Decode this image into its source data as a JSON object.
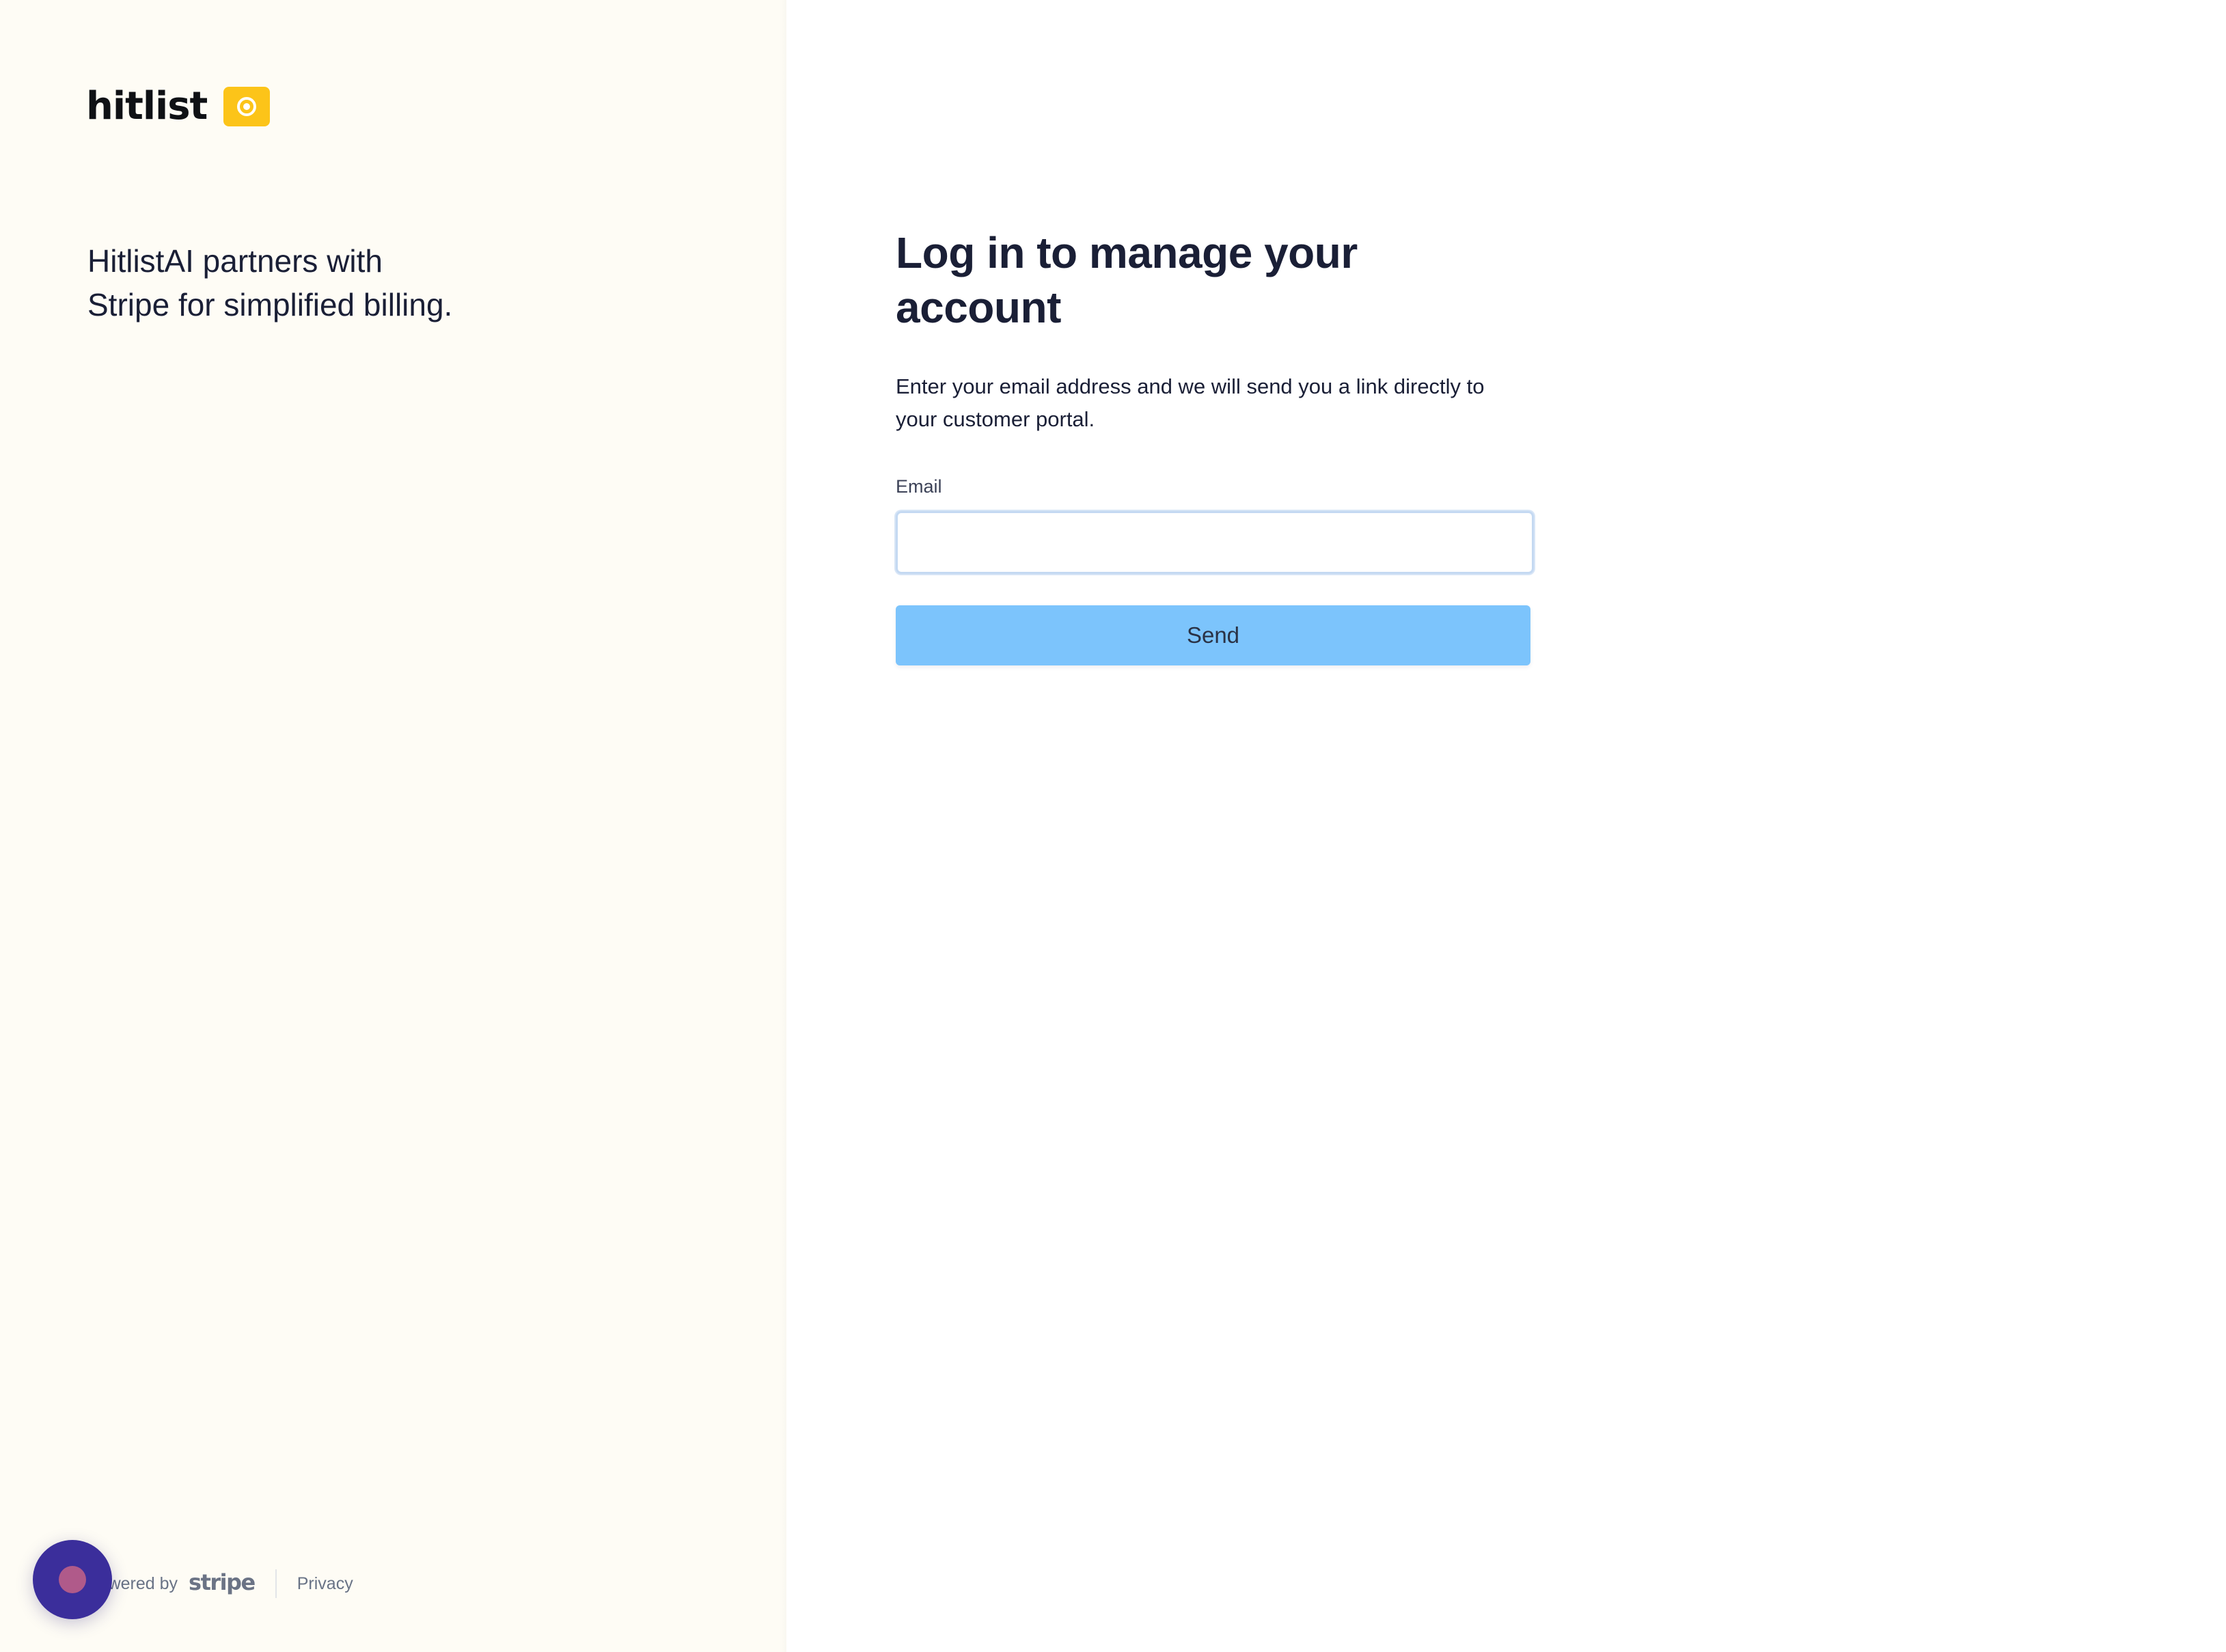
{
  "brand": {
    "logo_text": "hitlist",
    "badge_icon": "target-icon",
    "accent_color": "#fcc419"
  },
  "left_panel": {
    "tagline_line1": "HitlistAI partners with",
    "tagline_line2": "Stripe for simplified billing.",
    "background_color": "#fefcf5"
  },
  "footer": {
    "powered_by_text": "Powered by",
    "stripe_wordmark": "stripe",
    "privacy_label": "Privacy"
  },
  "form": {
    "title": "Log in to manage your account",
    "description": "Enter your email address and we will send you a link directly to your customer portal.",
    "email_label": "Email",
    "email_value": "",
    "email_placeholder": "",
    "send_label": "Send",
    "send_color": "#7cc4fc"
  },
  "chat_widget": {
    "icon": "chat-bubble-icon",
    "color": "#3b2e9b"
  }
}
